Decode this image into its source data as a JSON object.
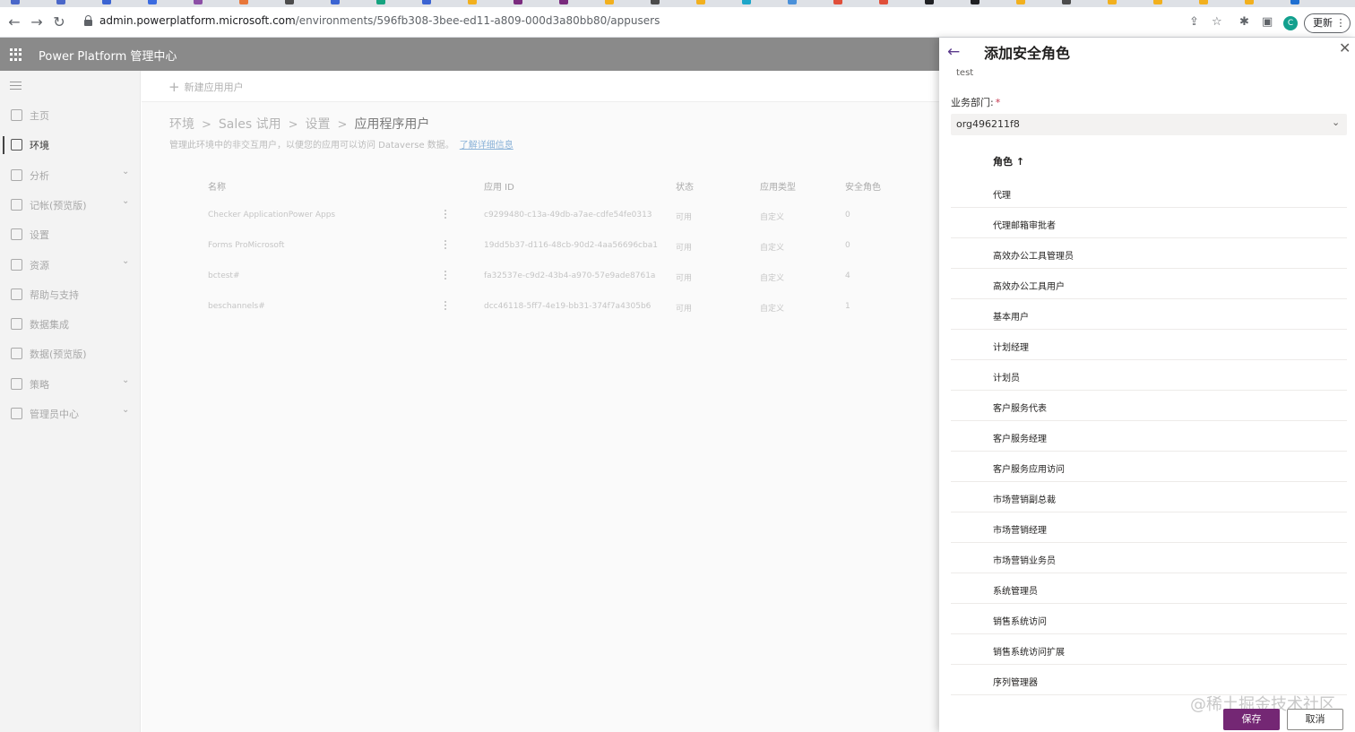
{
  "browser": {
    "url_host": "admin.powerplatform.microsoft.com",
    "url_path": "/environments/596fb308-3bee-ed11-a809-000d3a80bb80/appusers",
    "update_label": "更新",
    "profile_initial": "C"
  },
  "header": {
    "app_title": "Power Platform 管理中心"
  },
  "sidebar": {
    "items": [
      {
        "label": "主页",
        "chevron": false,
        "active": false
      },
      {
        "label": "环境",
        "chevron": false,
        "active": true
      },
      {
        "label": "分析",
        "chevron": true,
        "active": false
      },
      {
        "label": "记帐(预览版)",
        "chevron": true,
        "active": false
      },
      {
        "label": "设置",
        "chevron": false,
        "active": false
      },
      {
        "label": "资源",
        "chevron": true,
        "active": false
      },
      {
        "label": "帮助与支持",
        "chevron": false,
        "active": false
      },
      {
        "label": "数据集成",
        "chevron": false,
        "active": false
      },
      {
        "label": "数据(预览版)",
        "chevron": false,
        "active": false
      },
      {
        "label": "策略",
        "chevron": true,
        "active": false
      },
      {
        "label": "管理员中心",
        "chevron": true,
        "active": false
      }
    ]
  },
  "main": {
    "new_user_label": "新建应用用户",
    "breadcrumb": [
      "环境",
      "Sales 试用",
      "设置",
      "应用程序用户"
    ],
    "description": "管理此环境中的非交互用户，以便您的应用可以访问 Dataverse 数据。",
    "learn_more": "了解详细信息",
    "columns": [
      "名称",
      "应用 ID",
      "状态",
      "应用类型",
      "安全角色"
    ],
    "rows": [
      {
        "name": "Checker ApplicationPower Apps",
        "app_id": "c9299480-c13a-49db-a7ae-cdfe54fe0313",
        "status": "可用",
        "type": "自定义",
        "roles": "0"
      },
      {
        "name": "Forms ProMicrosoft",
        "app_id": "19dd5b37-d116-48cb-90d2-4aa56696cba1",
        "status": "可用",
        "type": "自定义",
        "roles": "0"
      },
      {
        "name": "bctest#",
        "app_id": "fa32537e-c9d2-43b4-a970-57e9ade8761a",
        "status": "可用",
        "type": "自定义",
        "roles": "4"
      },
      {
        "name": "beschannels#",
        "app_id": "dcc46118-5ff7-4e19-bb31-374f7a4305b6",
        "status": "可用",
        "type": "自定义",
        "roles": "1"
      }
    ]
  },
  "panel": {
    "title": "添加安全角色",
    "subtitle": "test",
    "business_unit_label": "业务部门:",
    "required_marker": "*",
    "business_unit_value": "org496211f8",
    "role_column_header": "角色 ↑",
    "roles": [
      "代理",
      "代理邮箱审批者",
      "高效办公工具管理员",
      "高效办公工具用户",
      "基本用户",
      "计划经理",
      "计划员",
      "客户服务代表",
      "客户服务经理",
      "客户服务应用访问",
      "市场营销副总裁",
      "市场营销经理",
      "市场营销业务员",
      "系统管理员",
      "销售系统访问",
      "销售系统访问扩展",
      "序列管理器"
    ],
    "save_label": "保存",
    "cancel_label": "取消",
    "watermark": "@稀土掘金技术社区"
  }
}
